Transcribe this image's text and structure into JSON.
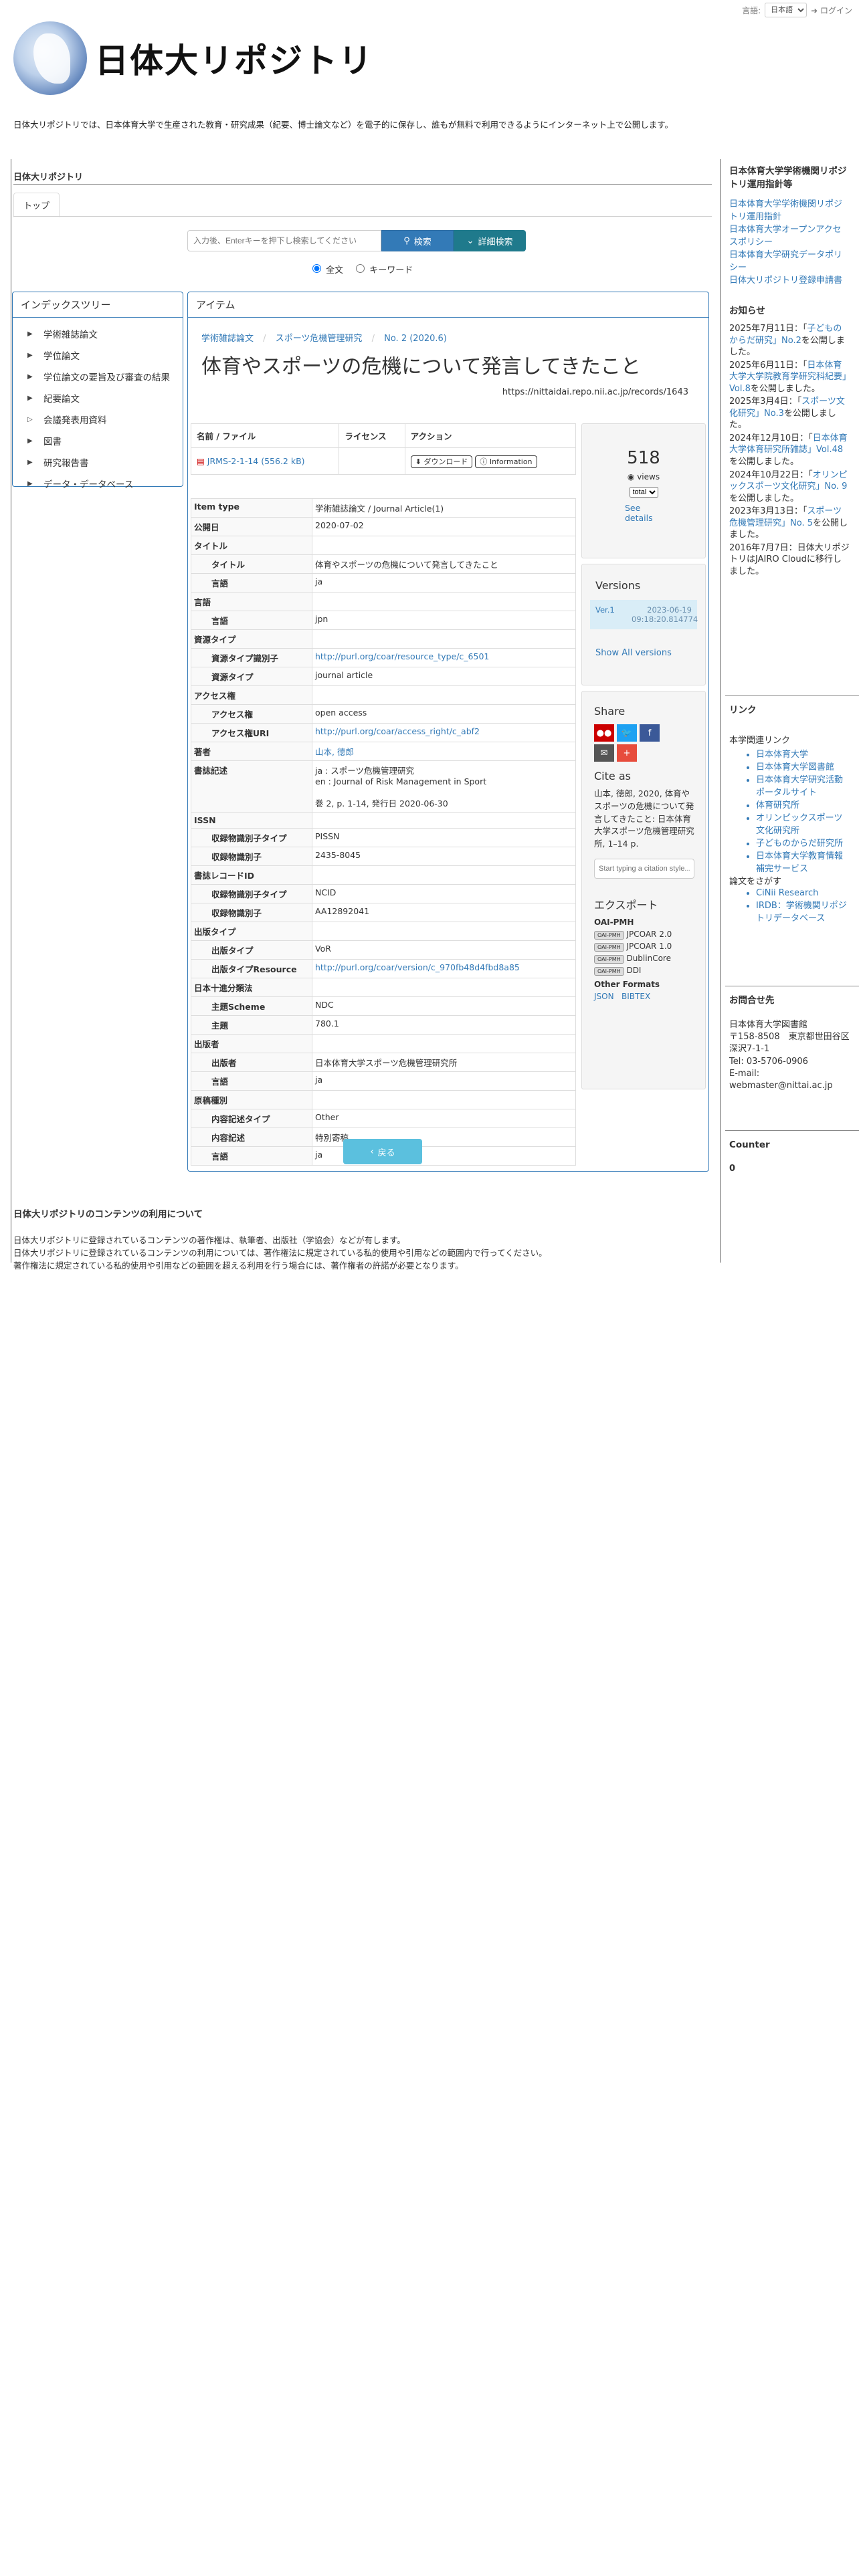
{
  "topbar": {
    "language_label": "言語:",
    "language_value": "日本語",
    "login": "ログイン"
  },
  "site": {
    "title": "日体大リポジトリ",
    "intro": "日体大リポジトリでは、日本体育大学で生産された教育・研究成果（紀要、博士論文など）を電子的に保存し、誰もが無料で利用できるようにインターネット上で公開します。"
  },
  "breadcrumb_title": "日体大リポジトリ",
  "tabs": [
    "トップ"
  ],
  "search": {
    "placeholder": "入力後、Enterキーを押下し検索してください",
    "search_button": "検索",
    "advanced_button": "詳細検索",
    "radio_fulltext": "全文",
    "radio_keyword": "キーワード"
  },
  "index_tree": {
    "title": "インデックスツリー",
    "items": [
      "学術雑誌論文",
      "学位論文",
      "学位論文の要旨及び審査の結果",
      "紀要論文",
      "会議発表用資料",
      "図書",
      "研究報告書",
      "データ・データベース"
    ]
  },
  "item": {
    "panel_title": "アイテム",
    "breadcrumb": [
      "学術雑誌論文",
      "スポーツ危機管理研究",
      "No. 2 (2020.6)"
    ],
    "title": "体育やスポーツの危機について発言してきたこと",
    "url": "https://nittaidai.repo.nii.ac.jp/records/1643",
    "file_headers": [
      "名前 / ファイル",
      "ライセンス",
      "アクション"
    ],
    "file_name": "JRMS-2-1-14 (556.2 kB)",
    "download": "ダウンロード",
    "information": "Information",
    "back": "戻る"
  },
  "metadata": [
    {
      "k": "Item type",
      "v": "学術雑誌論文 / Journal Article(1)",
      "level": 0
    },
    {
      "k": "公開日",
      "v": "2020-07-02",
      "level": 0
    },
    {
      "k": "タイトル",
      "v": "",
      "level": 0
    },
    {
      "k": "タイトル",
      "v": "体育やスポーツの危機について発言してきたこと",
      "level": 1
    },
    {
      "k": "言語",
      "v": "ja",
      "level": 1
    },
    {
      "k": "言語",
      "v": "",
      "level": 0
    },
    {
      "k": "言語",
      "v": "jpn",
      "level": 1
    },
    {
      "k": "資源タイプ",
      "v": "",
      "level": 0
    },
    {
      "k": "資源タイプ識別子",
      "v": "http://purl.org/coar/resource_type/c_6501",
      "level": 1,
      "link": true
    },
    {
      "k": "資源タイプ",
      "v": "journal article",
      "level": 1
    },
    {
      "k": "アクセス権",
      "v": "",
      "level": 0
    },
    {
      "k": "アクセス権",
      "v": "open access",
      "level": 1
    },
    {
      "k": "アクセス権URI",
      "v": "http://purl.org/coar/access_right/c_abf2",
      "level": 1,
      "link": true
    },
    {
      "k": "著者",
      "v": "山本, 徳郎",
      "level": 0,
      "link": true
    },
    {
      "k": "書誌記述",
      "v": "ja : スポーツ危機管理研究\nen : Journal of Risk Management in Sport\n\n巻 2, p. 1-14, 発行日 2020-06-30",
      "level": 0
    },
    {
      "k": "ISSN",
      "v": "",
      "level": 0
    },
    {
      "k": "収録物識別子タイプ",
      "v": "PISSN",
      "level": 1
    },
    {
      "k": "収録物識別子",
      "v": "2435-8045",
      "level": 1
    },
    {
      "k": "書誌レコードID",
      "v": "",
      "level": 0
    },
    {
      "k": "収録物識別子タイプ",
      "v": "NCID",
      "level": 1
    },
    {
      "k": "収録物識別子",
      "v": "AA12892041",
      "level": 1
    },
    {
      "k": "出版タイプ",
      "v": "",
      "level": 0
    },
    {
      "k": "出版タイプ",
      "v": "VoR",
      "level": 1
    },
    {
      "k": "出版タイプResource",
      "v": "http://purl.org/coar/version/c_970fb48d4fbd8a85",
      "level": 1,
      "link": true
    },
    {
      "k": "日本十進分類法",
      "v": "",
      "level": 0
    },
    {
      "k": "主題Scheme",
      "v": "NDC",
      "level": 1
    },
    {
      "k": "主題",
      "v": "780.1",
      "level": 1
    },
    {
      "k": "出版者",
      "v": "",
      "level": 0
    },
    {
      "k": "出版者",
      "v": "日本体育大学スポーツ危機管理研究所",
      "level": 1
    },
    {
      "k": "言語",
      "v": "ja",
      "level": 1
    },
    {
      "k": "原稿種別",
      "v": "",
      "level": 0
    },
    {
      "k": "内容記述タイプ",
      "v": "Other",
      "level": 1
    },
    {
      "k": "内容記述",
      "v": "特別寄稿",
      "level": 1
    },
    {
      "k": "言語",
      "v": "ja",
      "level": 1
    }
  ],
  "stats": {
    "count": "518",
    "views": "views",
    "select": "total",
    "see_details": "See details"
  },
  "versions": {
    "title": "Versions",
    "label": "Ver.1",
    "date": "2023-06-19 09:18:20.814774",
    "show_all": "Show All versions"
  },
  "share": {
    "title": "Share"
  },
  "cite": {
    "title": "Cite as",
    "text": "山本, 徳郎, 2020, 体育やスポーツの危機について発言してきたこと: 日本体育大学スポーツ危機管理研究所, 1–14 p.",
    "placeholder": "Start typing a citation style..."
  },
  "export": {
    "title": "エクスポート",
    "oai_title": "OAI-PMH",
    "oai_items": [
      "JPCOAR 2.0",
      "JPCOAR 1.0",
      "DublinCore",
      "DDI"
    ],
    "badge": "OAI-PMH",
    "other_title": "Other Formats",
    "other_items": [
      "JSON",
      "BIBTEX"
    ]
  },
  "right": {
    "policy_title": "日本体育大学学術機関リポジトリ運用指針等",
    "policy_links": [
      "日本体育大学学術機関リポジトリ運用指針",
      "日本体育大学オープンアクセスポリシー",
      "日本体育大学研究データポリシー",
      "日体大リポジトリ登録申請書"
    ],
    "news_title": "お知らせ",
    "news": [
      {
        "pre": "2025年7月11日：「",
        "link": "子どものからだ研究」No.2",
        "post": "を公開しました。"
      },
      {
        "pre": "2025年6月11日：「",
        "link": "日本体育大学大学院教育学研究科紀要」Vol.8",
        "post": "を公開しました。"
      },
      {
        "pre": "2025年3月4日：「",
        "link": "スポーツ文化研究」No.3",
        "post": "を公開しました。"
      },
      {
        "pre": "2024年12月10日：「",
        "link": "日本体育大学体育研究所雑誌」Vol.48",
        "post": "を公開しました。"
      },
      {
        "pre": "2024年10月22日：「",
        "link": "オリンピックスポーツ文化研究」No. 9",
        "post": "を公開しました。"
      },
      {
        "pre": "2023年3月13日：「",
        "link": "スポーツ危機管理研究」No. 5",
        "post": "を公開しました。"
      },
      {
        "pre": "2016年7月7日：日体大リポジトリはJAIRO Cloudに移行しました。",
        "link": "",
        "post": ""
      }
    ],
    "links_title": "リンク",
    "links_head": "本学関連リンク",
    "links_sub": [
      "日本体育大学",
      "日本体育大学図書館",
      "日本体育大学研究活動ポータルサイト",
      "体育研究所",
      "オリンピックスポーツ文化研究所",
      "子どものからだ研究所",
      "日本体育大学教育情報補完サービス"
    ],
    "search_head": "論文をさがす",
    "search_sub": [
      "CiNii Research",
      "IRDB：学術機関リポジトリデータベース"
    ],
    "contact_title": "お問合せ先",
    "contact": [
      "日本体育大学図書館",
      "〒158-8508　東京都世田谷区深沢7-1-1",
      "Tel: 03-5706-0906",
      "E-mail: webmaster@nittai.ac.jp"
    ],
    "counter_title": "Counter",
    "counter_value": "0"
  },
  "footer": {
    "title": "日体大リポジトリのコンテンツの利用について",
    "lines": [
      "日体大リポジトリに登録されているコンテンツの著作権は、執筆者、出版社（学協会）などが有します。",
      "日体大リポジトリに登録されているコンテンツの利用については、著作権法に規定されている私的使用や引用などの範囲内で行ってください。",
      "著作権法に規定されている私的使用や引用などの範囲を超える利用を行う場合には、著作権者の許諾が必要となります。"
    ]
  }
}
